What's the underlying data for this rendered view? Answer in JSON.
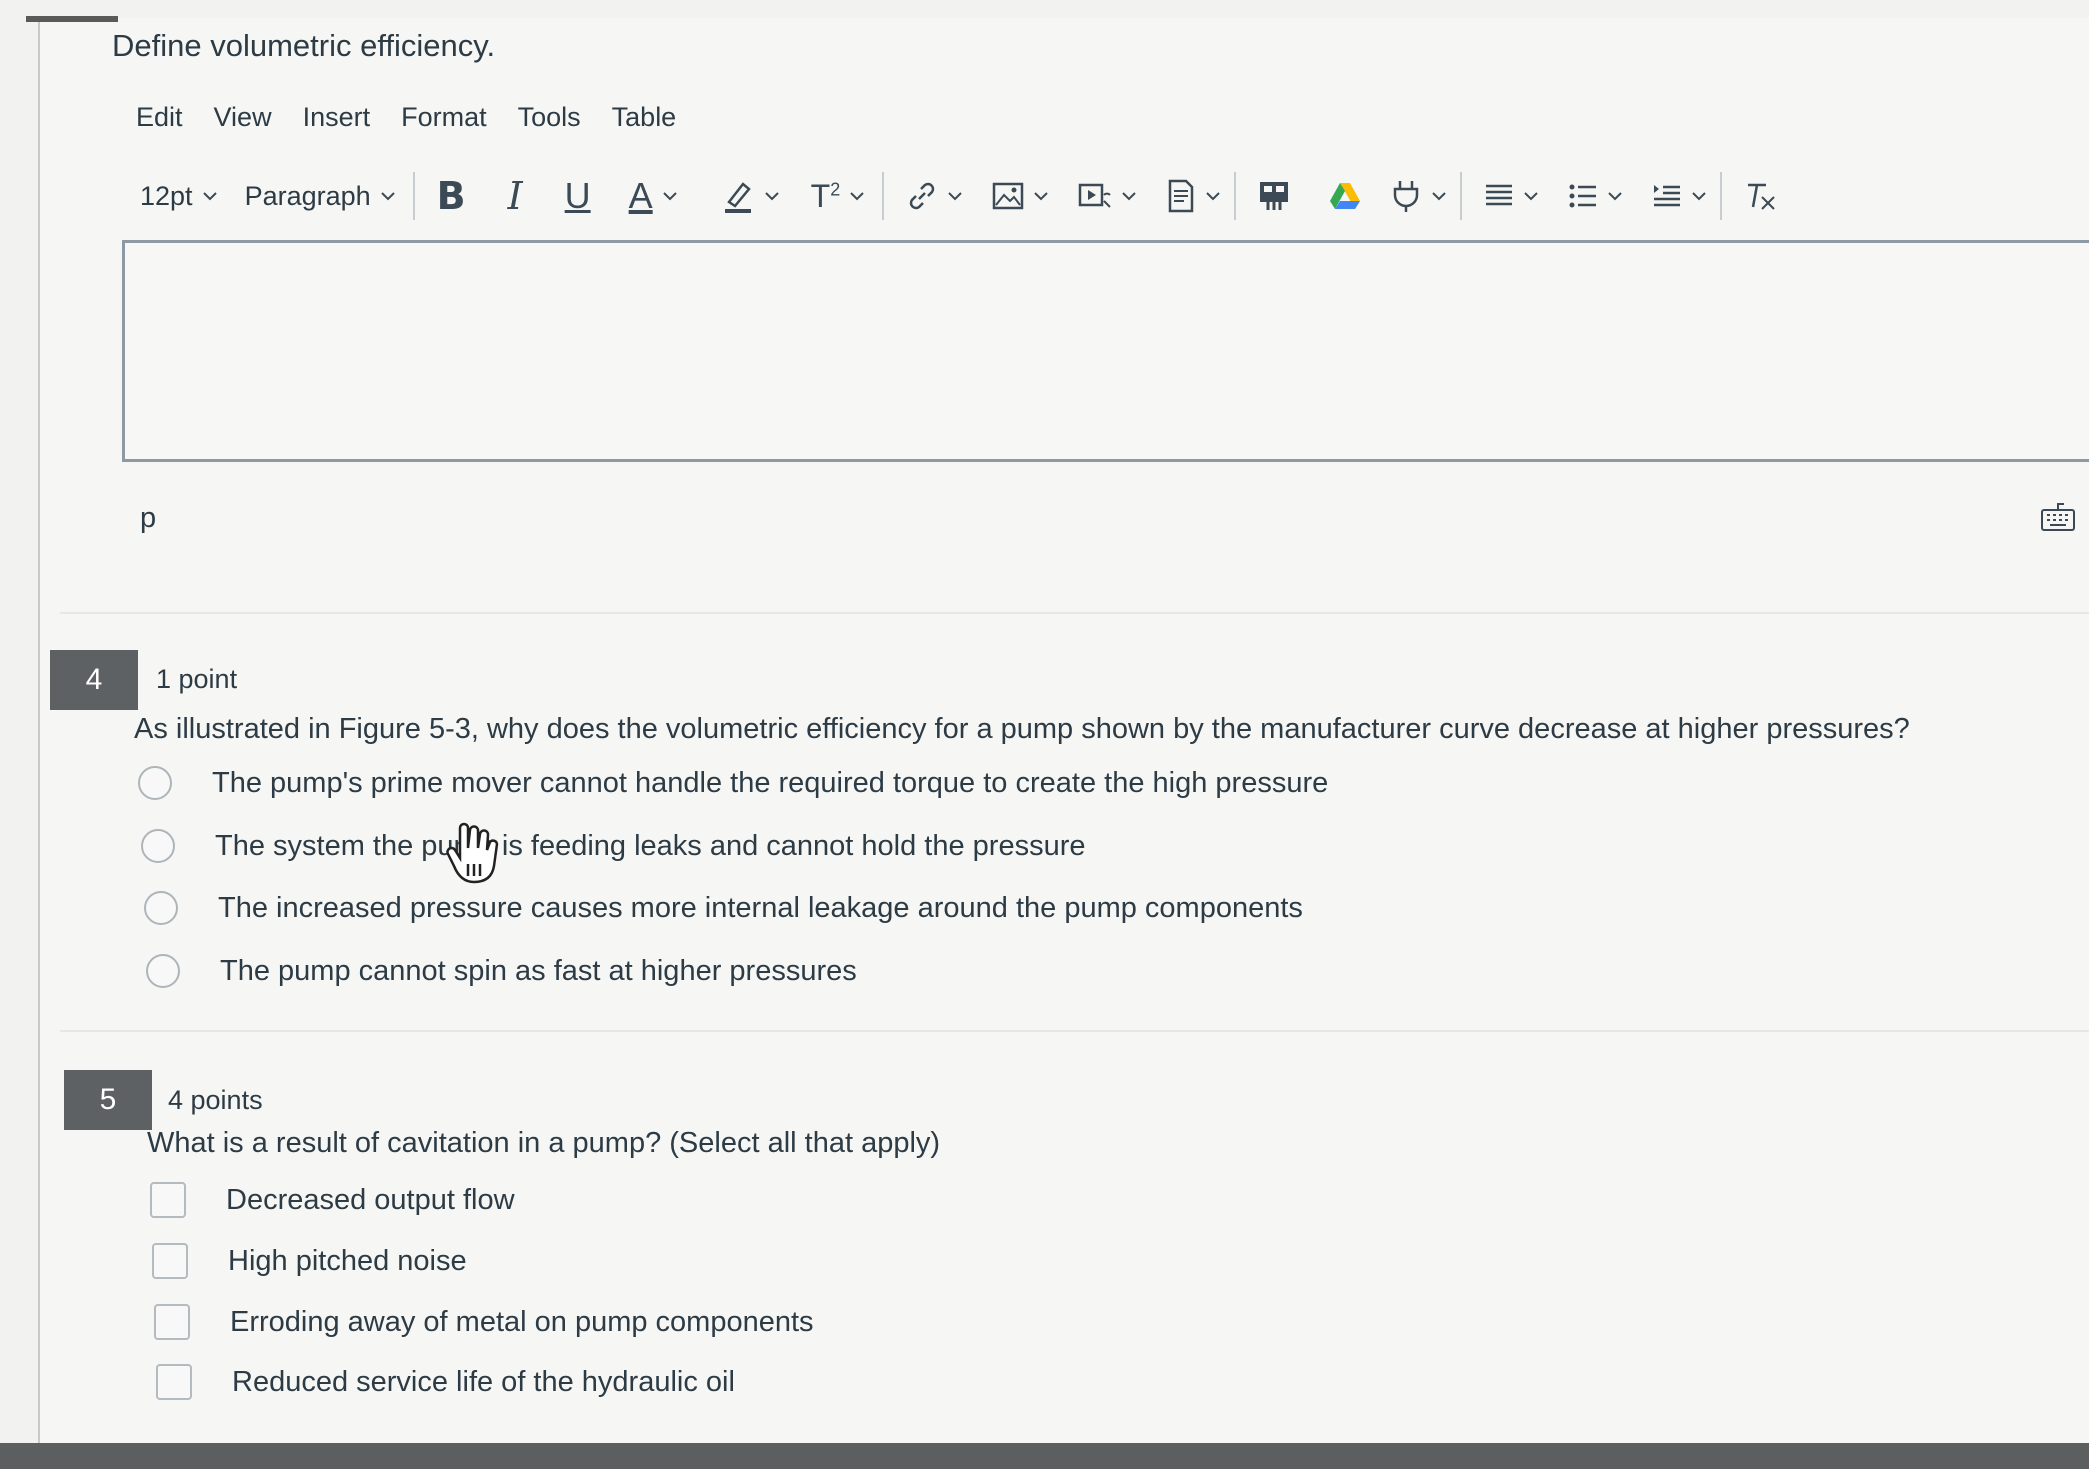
{
  "prev_question": {
    "title": "Define volumetric efficiency."
  },
  "editor": {
    "menubar": [
      "Edit",
      "View",
      "Insert",
      "Format",
      "Tools",
      "Table"
    ],
    "font_size": "12pt",
    "block_format": "Paragraph",
    "status_path": "p",
    "toolbar_icons": [
      "bold-icon",
      "italic-icon",
      "underline-icon",
      "text-color-icon",
      "highlight-icon",
      "superscript-icon",
      "link-icon",
      "image-icon",
      "media-icon",
      "document-icon",
      "apps-icon",
      "google-drive-icon",
      "plugin-icon",
      "align-icon",
      "bullet-list-icon",
      "indent-icon",
      "clear-format-icon"
    ],
    "bold_glyph": "B",
    "italic_glyph": "I",
    "underline_glyph": "U",
    "text_color_glyph": "A",
    "superscript_glyph": "T",
    "superscript_sup": "2"
  },
  "questions": [
    {
      "number": "4",
      "points": "1 point",
      "text": "As illustrated in Figure 5-3, why does the volumetric efficiency for a pump shown by the manufacturer curve decrease at higher pressures?",
      "type": "radio",
      "options": [
        "The pump's prime mover cannot handle the required torque to create the high pressure",
        "The system the pump is feeding leaks and cannot hold the pressure",
        "The increased pressure causes more internal leakage around the pump components",
        "The pump cannot spin as fast at higher pressures"
      ]
    },
    {
      "number": "5",
      "points": "4 points",
      "text": "What is a result of cavitation in a pump? (Select all that apply)",
      "type": "checkbox",
      "options": [
        "Decreased output flow",
        "High pitched noise",
        "Erroding away of metal on pump components",
        "Reduced service life of the hydraulic oil"
      ]
    }
  ],
  "colors": {
    "text": "#2d3b45",
    "number_badge": "#5d6164",
    "editor_border": "#8e9aa3"
  }
}
